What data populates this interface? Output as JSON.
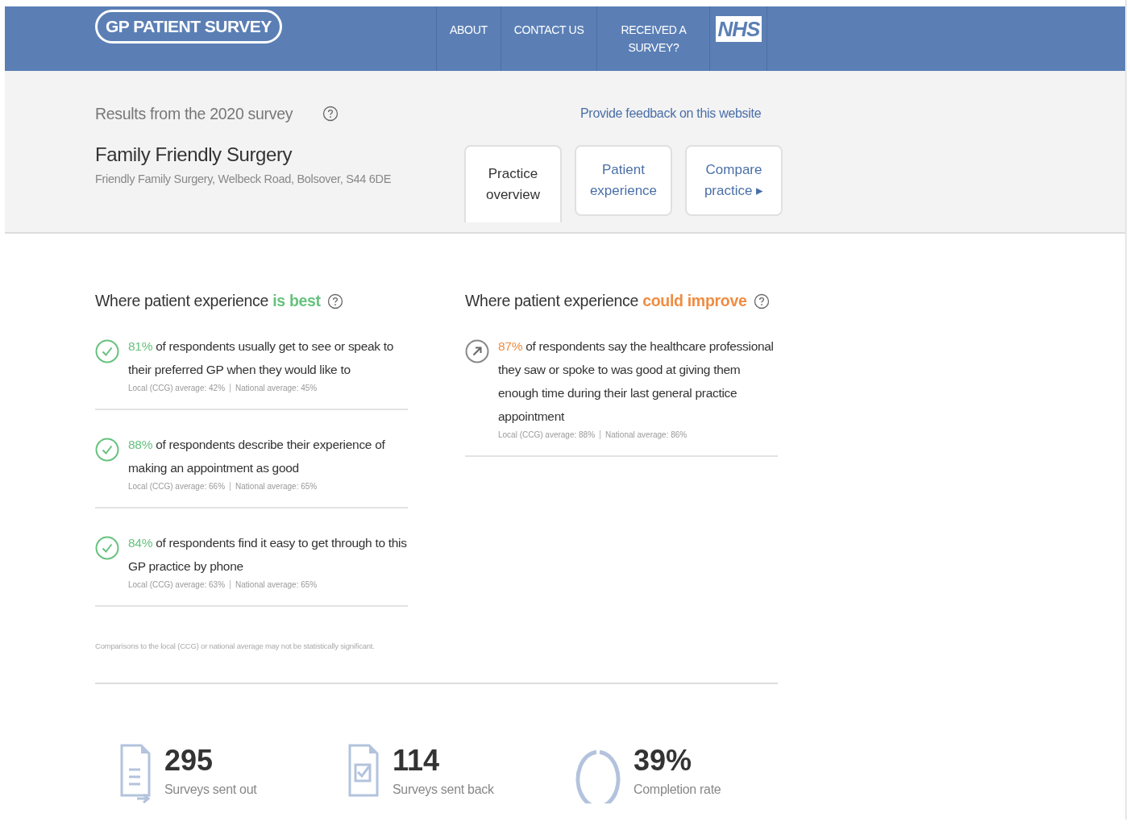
{
  "header": {
    "logo": "GP PATIENT SURVEY",
    "nav": [
      {
        "label": "ABOUT"
      },
      {
        "label": "CONTACT US"
      },
      {
        "label": "RECEIVED A SURVEY?"
      }
    ],
    "nhs_logo": "NHS"
  },
  "intro": {
    "results_label": "Results from the 2020 survey",
    "feedback_link": "Provide feedback on this website",
    "practice_name": "Family Friendly Surgery",
    "address": "Friendly Family Surgery, Welbeck Road, Bolsover, S44 6DE"
  },
  "tabs": [
    {
      "label": "Practice overview",
      "selected": true
    },
    {
      "label": "Patient experience",
      "selected": false
    },
    {
      "label": "Compare practice ▸",
      "selected": false
    }
  ],
  "sections": [
    {
      "kind": "best",
      "heading": "Where patient experience",
      "highlight": "is best",
      "items": [
        {
          "percent": "81%",
          "text": "of respondents usually get to see or speak to their preferred GP when they would like to",
          "local": "Local (CCG) average: 42%",
          "national": "National average: 45%"
        },
        {
          "percent": "88%",
          "text": "of respondents describe their experience of making an appointment as good",
          "local": "Local (CCG) average: 66%",
          "national": "National average: 65%"
        },
        {
          "percent": "84%",
          "text": "of respondents find it easy to get through to this GP practice by phone",
          "local": "Local (CCG) average: 63%",
          "national": "National average: 65%"
        }
      ]
    },
    {
      "kind": "improve",
      "heading": "Where patient experience",
      "highlight": "could improve",
      "items": [
        {
          "percent": "87%",
          "text": "of respondents say the healthcare professional they saw or spoke to was good at giving them enough time during their last general practice appointment",
          "local": "Local (CCG) average: 88%",
          "national": "National average: 86%"
        }
      ]
    }
  ],
  "footnote": "Comparisons to the local (CCG) or national average may not be statistically significant.",
  "stats": [
    {
      "kind": "sent",
      "value": "295",
      "label": "Surveys sent out"
    },
    {
      "kind": "returned",
      "value": "114",
      "label": "Surveys sent back"
    },
    {
      "kind": "rate",
      "value": "39%",
      "label": "Completion rate"
    }
  ]
}
